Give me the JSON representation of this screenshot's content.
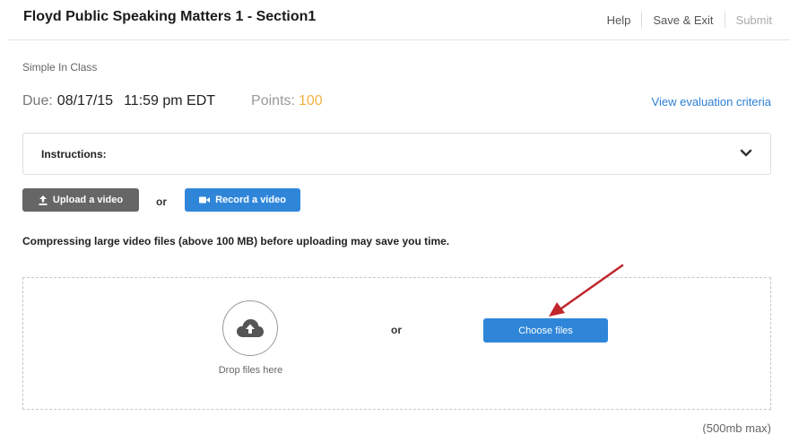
{
  "header": {
    "title": "Floyd Public Speaking Matters 1 - Section1",
    "help_label": "Help",
    "save_exit_label": "Save & Exit",
    "submit_label": "Submit"
  },
  "assignment": {
    "type": "Simple In Class",
    "due_label": "Due:",
    "due_date": "08/17/15",
    "due_time": "11:59 pm EDT",
    "points_label": "Points:",
    "points_value": "100",
    "eval_link": "View evaluation criteria"
  },
  "instructions": {
    "label": "Instructions:"
  },
  "video_options": {
    "upload_label": "Upload a video",
    "or_label": "or",
    "record_label": "Record a video",
    "note": "Compressing large video files (above 100 MB) before uploading may save you time."
  },
  "dropzone": {
    "drop_text": "Drop files here",
    "or_label": "or",
    "choose_label": "Choose files",
    "max_note": "(500mb max)"
  },
  "colors": {
    "accent_blue": "#2f86d9",
    "points_orange": "#f5b342",
    "upload_gray": "#666666",
    "annotation_arrow": "#c0262b"
  },
  "icons": [
    "upload-icon",
    "video-camera-icon",
    "cloud-upload-icon",
    "chevron-down-icon"
  ]
}
